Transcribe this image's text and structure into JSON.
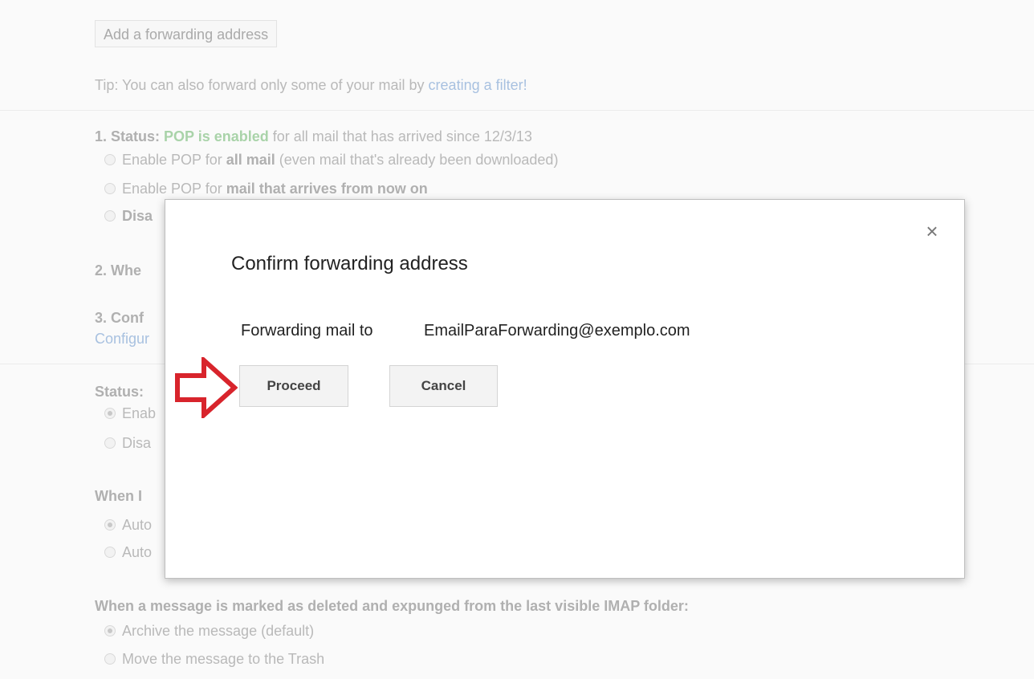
{
  "background": {
    "add_forwarding_button": "Add a forwarding address",
    "tip_prefix": "Tip: You can also forward only some of your mail by ",
    "tip_link": "creating a filter!",
    "pop_status_label": "1. Status: ",
    "pop_status_value": "POP is enabled",
    "pop_status_suffix": " for all mail that has arrived since 12/3/13",
    "pop_opt1_prefix": "Enable POP for ",
    "pop_opt1_bold": "all mail",
    "pop_opt1_suffix": " (even mail that's already been downloaded)",
    "pop_opt2_prefix": "Enable POP for ",
    "pop_opt2_bold": "mail that arrives from now on",
    "pop_opt3": "Disa",
    "section2": "2. Whe",
    "section3": "3. Conf",
    "configure_link": "Configur",
    "imap_status": "Status:",
    "imap_enable": "Enab",
    "imap_disable": "Disa",
    "when_i": "When I",
    "auto1": "Auto",
    "auto2": "Auto",
    "deleted_heading": "When a message is marked as deleted and expunged from the last visible IMAP folder:",
    "deleted_opt1": "Archive the message (default)",
    "deleted_opt2": "Move the message to the Trash"
  },
  "dialog": {
    "title": "Confirm forwarding address",
    "forwarding_label": "Forwarding mail to",
    "forwarding_email": "EmailParaForwarding@exemplo.com",
    "proceed_label": "Proceed",
    "cancel_label": "Cancel",
    "close_icon": "close-icon"
  },
  "colors": {
    "arrow": "#d8242c",
    "status_green": "#a9d3a9",
    "link_blue": "#a8c1e0"
  }
}
